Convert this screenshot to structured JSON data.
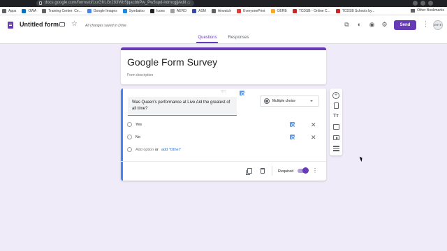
{
  "browser": {
    "url": "docs.google.com/forms/d/1rzGfrLGr283Wb5jqacbbPw_Pw3spd-lrdmcgjj/edit",
    "bookmarks": [
      {
        "label": "Apps",
        "color": "#5f6368"
      },
      {
        "label": "OWA",
        "color": "#0072c6"
      },
      {
        "label": "Training Center: Ce...",
        "color": "#5f6368"
      },
      {
        "label": "Google Images",
        "color": "#4285f4"
      },
      {
        "label": "Symbaloo",
        "color": "#1e88e5"
      },
      {
        "label": "Icons",
        "color": "#202124"
      },
      {
        "label": "AERO",
        "color": "#9e9e9e"
      },
      {
        "label": "ASM",
        "color": "#3949ab"
      },
      {
        "label": "Airwatch",
        "color": "#616161"
      },
      {
        "label": "EveryonePrint",
        "color": "#e53935"
      },
      {
        "label": "OERB",
        "color": "#f9a825"
      },
      {
        "label": "TCDSB - Online C...",
        "color": "#c62828"
      },
      {
        "label": "TCDSB Schools by...",
        "color": "#c62828"
      }
    ],
    "other_bookmarks": "Other Bookmarks"
  },
  "header": {
    "doc_title": "Untitled form",
    "saved_status": "All changes saved in Drive",
    "send_label": "Send",
    "avatar_text": "ERTE",
    "accent_color": "#673ab7"
  },
  "tabs": [
    {
      "label": "Questions",
      "active": true
    },
    {
      "label": "Responses",
      "active": false
    }
  ],
  "form": {
    "title": "Google Form Survey",
    "description_placeholder": "Form description"
  },
  "question": {
    "text": "Was Queen's performance at Live Aid the greatest of all time?",
    "type": "Multiple choice",
    "options": [
      "Yes",
      "No"
    ],
    "add_option": "Add option",
    "or": "or",
    "add_other": "add \"Other\"",
    "required_label": "Required",
    "required": true
  },
  "toolbar": {
    "icons": [
      "add-question-icon",
      "import-questions-icon",
      "add-title-icon",
      "add-image-icon",
      "add-video-icon",
      "add-section-icon"
    ]
  }
}
